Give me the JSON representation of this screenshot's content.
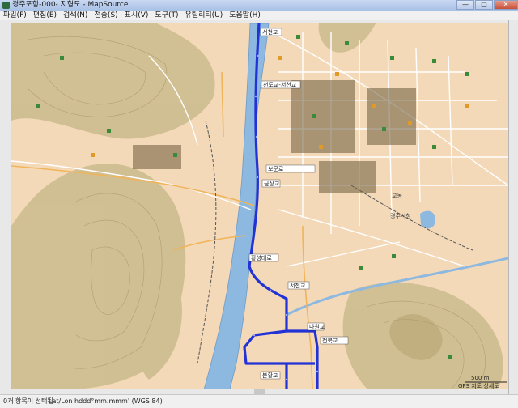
{
  "window": {
    "title": "경주포항-000- 지형도 - MapSource",
    "minimize": "—",
    "maximize": "□",
    "close": "✕"
  },
  "menu": [
    "파일(F)",
    "편집(E)",
    "검색(N)",
    "전송(S)",
    "표시(V)",
    "도구(T)",
    "유틸리티(U)",
    "도움말(H)"
  ],
  "map": {
    "labels": [
      "서천교",
      "선도교-서천교",
      "보문로",
      "금장교",
      "황성대로",
      "서천교",
      "나원교",
      "천북교",
      "분황교",
      "교동",
      "경주시청"
    ],
    "scale_label": "500 m",
    "gps_mode_label": "GPS 지도 상세도",
    "colors": {
      "land": "#f4d9b8",
      "water": "#8db8e0",
      "terrain": "#cbbb8e",
      "route": "#2233d6",
      "road": "#ffffff"
    }
  },
  "status": {
    "selection": "0개 항목이 선택됨",
    "coord_format": "Lat/Lon hddd°mm.mmm' (WGS 84)"
  }
}
